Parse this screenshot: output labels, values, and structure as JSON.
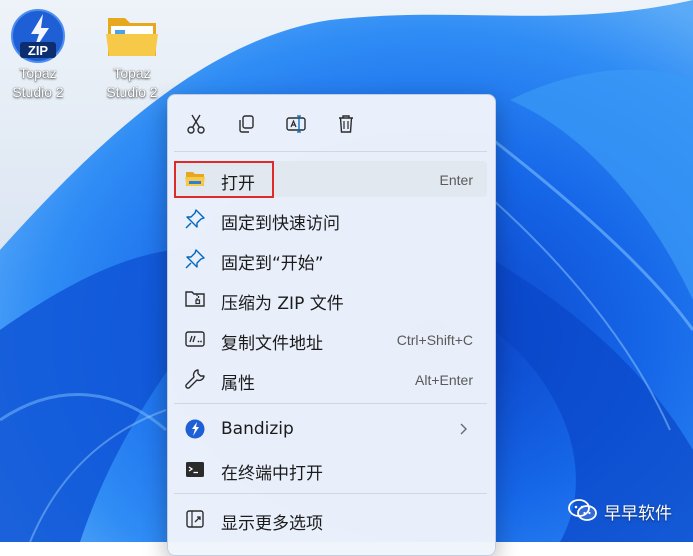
{
  "desktop": {
    "icons": [
      {
        "label": "Topaz Studio 2",
        "type": "zip",
        "badge_text": "ZIP"
      },
      {
        "label": "Topaz Studio 2",
        "type": "folder"
      }
    ]
  },
  "context_menu": {
    "toolbar": [
      {
        "name": "cut",
        "icon": "scissors-icon"
      },
      {
        "name": "copy",
        "icon": "copy-icon"
      },
      {
        "name": "rename",
        "icon": "rename-icon"
      },
      {
        "name": "delete",
        "icon": "trash-icon"
      }
    ],
    "items": [
      {
        "label": "打开",
        "shortcut": "Enter",
        "icon": "folder-icon"
      },
      {
        "label": "固定到快速访问",
        "shortcut": "",
        "icon": "pin-icon"
      },
      {
        "label": "固定到“开始”",
        "shortcut": "",
        "icon": "pin-icon"
      },
      {
        "label": "压缩为 ZIP 文件",
        "shortcut": "",
        "icon": "zip-archive-icon"
      },
      {
        "label": "复制文件地址",
        "shortcut": "Ctrl+Shift+C",
        "icon": "copy-path-icon"
      },
      {
        "label": "属性",
        "shortcut": "Alt+Enter",
        "icon": "wrench-icon"
      },
      {
        "label": "Bandizip",
        "shortcut": "",
        "icon": "bandizip-icon",
        "has_submenu": true
      },
      {
        "label": "在终端中打开",
        "shortcut": "",
        "icon": "terminal-icon"
      },
      {
        "label": "显示更多选项",
        "shortcut": "",
        "icon": "more-options-icon"
      }
    ]
  },
  "watermark": {
    "text": "早早软件",
    "icon": "wechat-icon"
  },
  "colors": {
    "accent": "#0067c0",
    "highlight_box": "#e02a2a",
    "menu_bg": "#eff4fb",
    "wallpaper_blue": "#1565e0"
  }
}
